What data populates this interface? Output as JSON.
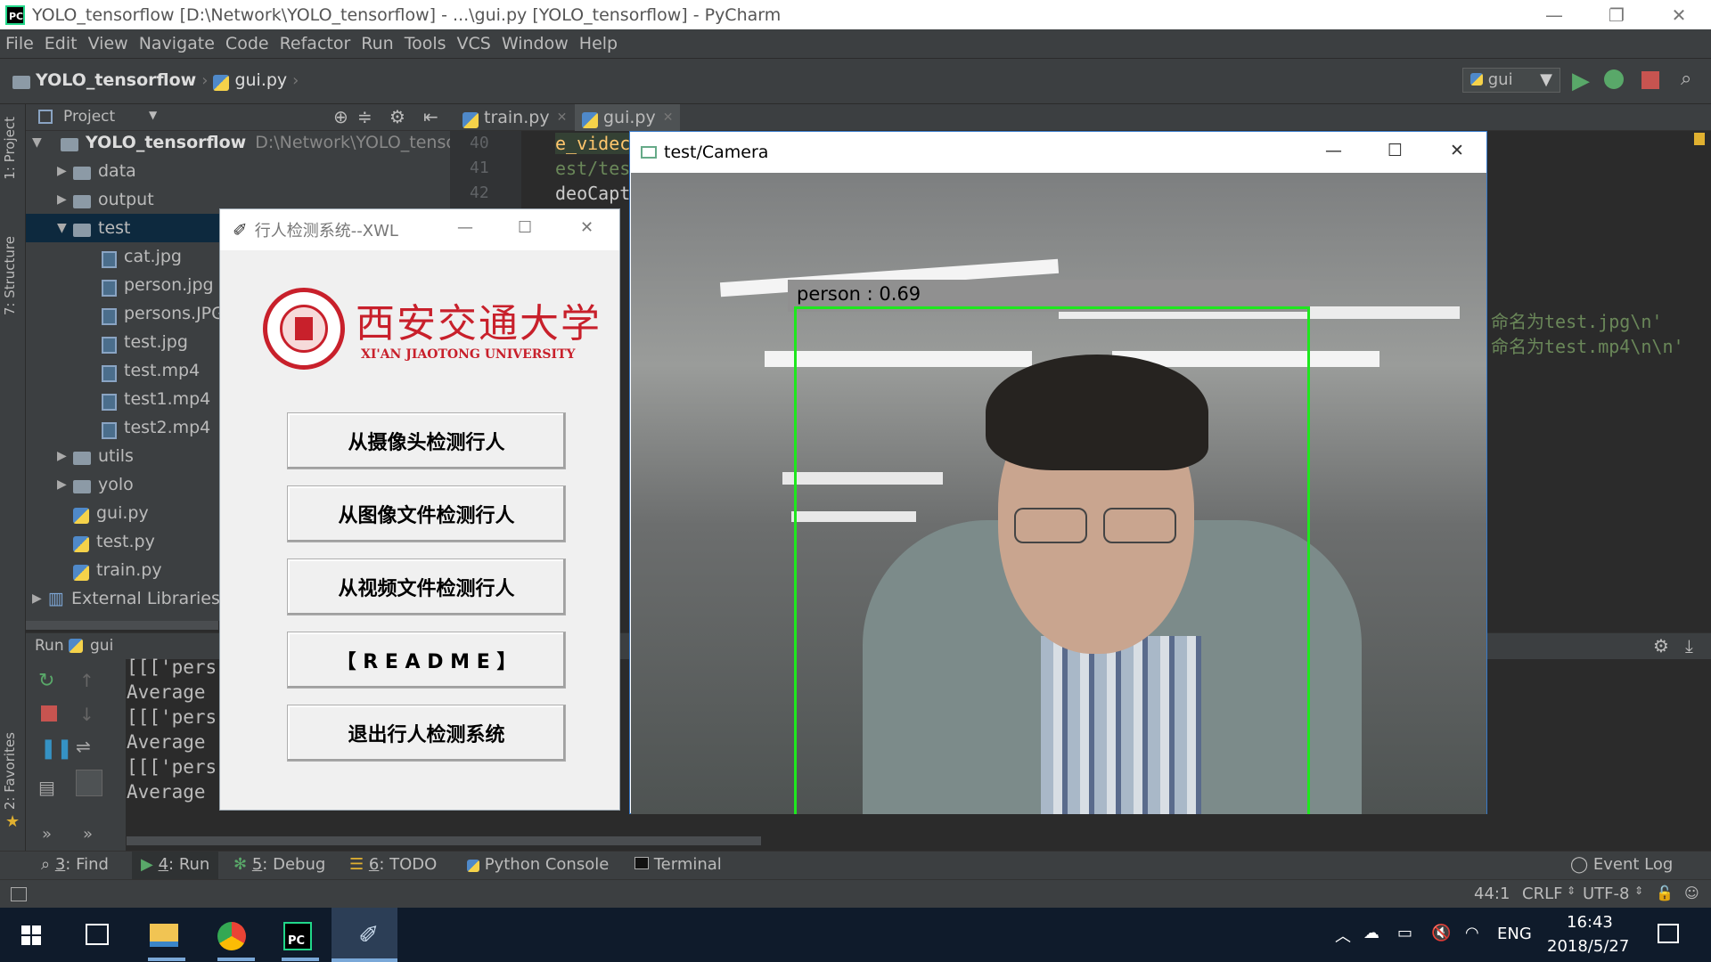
{
  "window": {
    "title": "YOLO_tensorflow [D:\\Network\\YOLO_tensorflow] - ...\\gui.py [YOLO_tensorflow] - PyCharm",
    "logo_text": "PC"
  },
  "menu": [
    "File",
    "Edit",
    "View",
    "Navigate",
    "Code",
    "Refactor",
    "Run",
    "Tools",
    "VCS",
    "Window",
    "Help"
  ],
  "breadcrumb": {
    "project": "YOLO_tensorflow",
    "file": "gui.py"
  },
  "run_config": "gui",
  "side_tabs": {
    "project": "1: Project",
    "structure": "7: Structure",
    "favorites": "2: Favorites"
  },
  "project_panel": {
    "header": "Project",
    "root": "YOLO_tensorflow",
    "root_path": "D:\\Network\\YOLO_tensorflo",
    "tree": [
      {
        "label": "data",
        "type": "folder",
        "level": 1,
        "arrow": "▶"
      },
      {
        "label": "output",
        "type": "folder",
        "level": 1,
        "arrow": "▶"
      },
      {
        "label": "test",
        "type": "folder",
        "level": 1,
        "arrow": "▼",
        "selected": true
      },
      {
        "label": "cat.jpg",
        "type": "image",
        "level": 2
      },
      {
        "label": "person.jpg",
        "type": "image",
        "level": 2
      },
      {
        "label": "persons.JPG",
        "type": "image",
        "level": 2
      },
      {
        "label": "test.jpg",
        "type": "image",
        "level": 2
      },
      {
        "label": "test.mp4",
        "type": "image",
        "level": 2
      },
      {
        "label": "test1.mp4",
        "type": "image",
        "level": 2
      },
      {
        "label": "test2.mp4",
        "type": "image",
        "level": 2
      },
      {
        "label": "utils",
        "type": "folder",
        "level": 1,
        "arrow": "▶"
      },
      {
        "label": "yolo",
        "type": "folder",
        "level": 1,
        "arrow": "▶"
      },
      {
        "label": "gui.py",
        "type": "py",
        "level": 1
      },
      {
        "label": "test.py",
        "type": "py",
        "level": 1
      },
      {
        "label": "train.py",
        "type": "py",
        "level": 1
      },
      {
        "label": "External Libraries",
        "type": "lib",
        "level": 0,
        "arrow": "▶"
      }
    ]
  },
  "editor": {
    "tabs": [
      "train.py",
      "gui.py"
    ],
    "line_numbers": [
      "40",
      "41",
      "42"
    ],
    "code_lines": [
      "e_videc",
      "est/tes",
      "deoCapt"
    ],
    "right_code": [
      "命名为test.jpg\\n'",
      "命名为test.mp4\\n\\n'"
    ]
  },
  "run_panel": {
    "label": "Run",
    "config": "gui",
    "output": [
      "[[['pers",
      "Average",
      "[[['pers",
      "Average",
      "[[['pers",
      "Average"
    ]
  },
  "bottom_tabs": [
    {
      "num": "3",
      "label": "Find"
    },
    {
      "num": "4",
      "label": "Run"
    },
    {
      "num": "5",
      "label": "Debug"
    },
    {
      "num": "6",
      "label": "TODO"
    },
    {
      "num": "",
      "label": "Python Console"
    },
    {
      "num": "",
      "label": "Terminal"
    }
  ],
  "event_log": "Event Log",
  "status": {
    "position": "44:1",
    "line_sep": "CRLF",
    "encoding": "UTF-8"
  },
  "gui_window": {
    "title": "行人检测系统--XWL",
    "logo_cn": "西安交通大学",
    "logo_en": "XI'AN JIAOTONG UNIVERSITY",
    "buttons": [
      "从摄像头检测行人",
      "从图像文件检测行人",
      "从视频文件检测行人",
      "【 R E A D M E 】",
      "退出行人检测系统"
    ]
  },
  "camera_window": {
    "title": "test/Camera",
    "detection_label": "person : 0.69",
    "detection_color": "#1ee81e"
  },
  "taskbar": {
    "language": "ENG",
    "time": "16:43",
    "date": "2018/5/27"
  },
  "colors": {
    "ide_bg": "#2b2b2b",
    "panel_bg": "#3c3f41",
    "taskbar_bg": "#0f1b2b",
    "xjtu_red": "#c8202b"
  }
}
